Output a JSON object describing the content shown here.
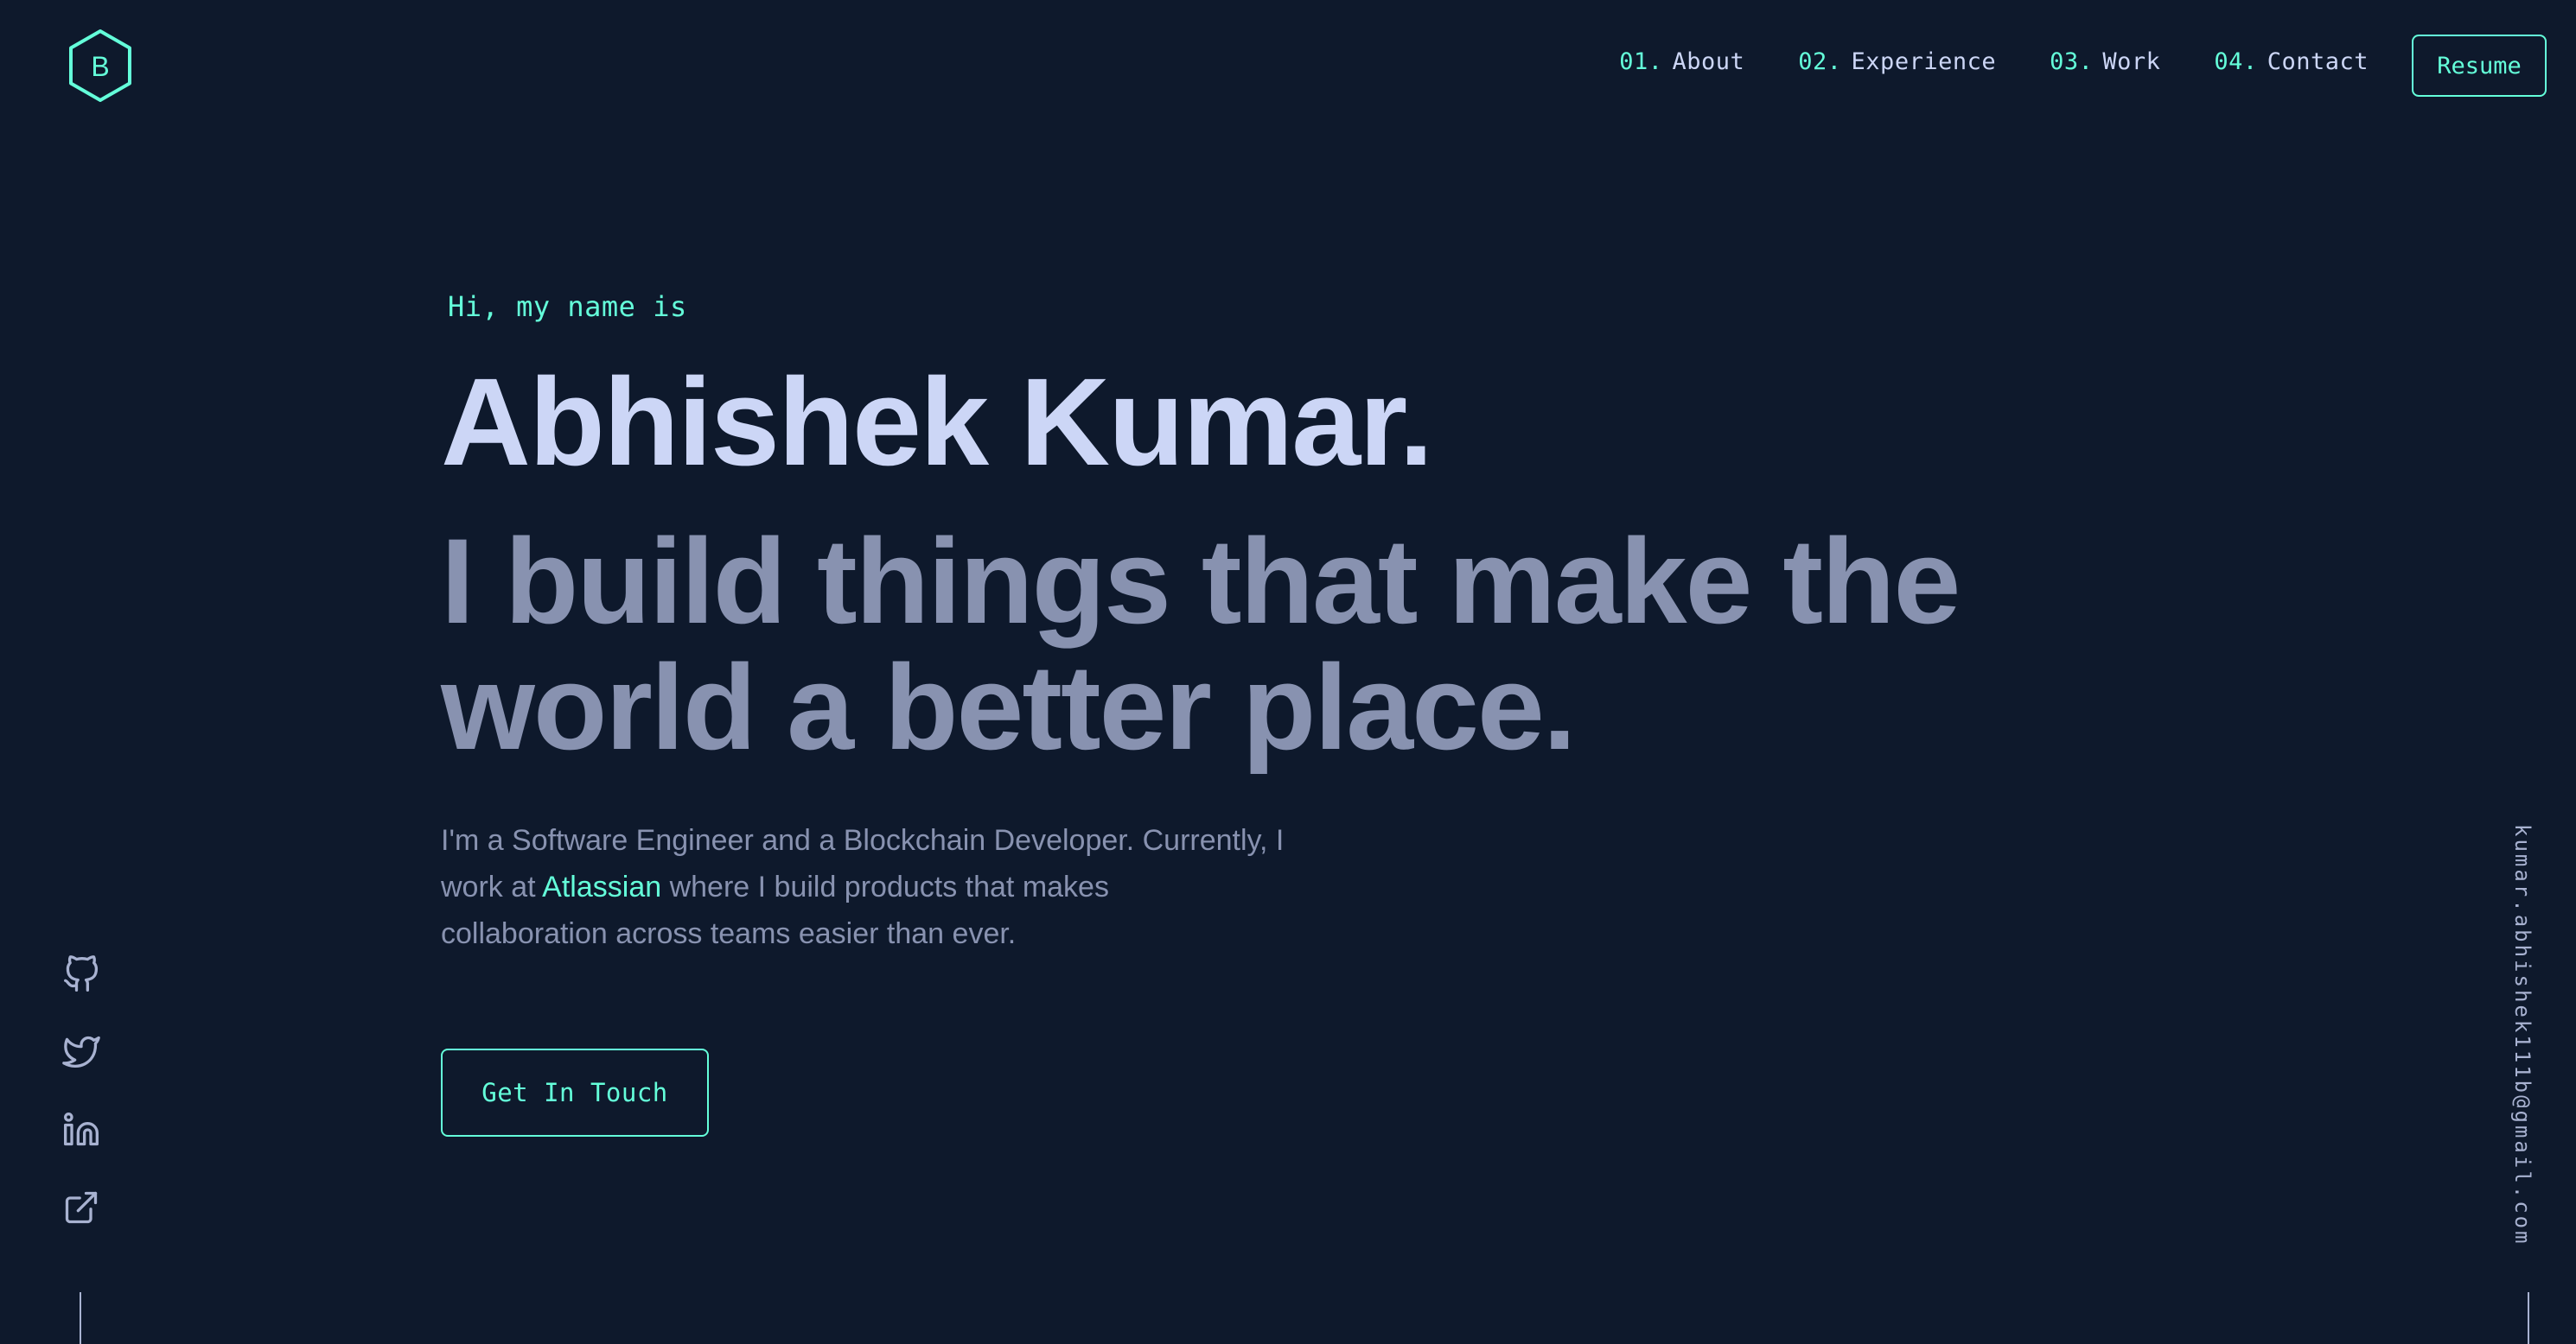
{
  "header": {
    "logo_letter": "B",
    "nav": [
      {
        "num": "01.",
        "label": "About"
      },
      {
        "num": "02.",
        "label": "Experience"
      },
      {
        "num": "03.",
        "label": "Work"
      },
      {
        "num": "04.",
        "label": "Contact"
      }
    ],
    "resume_label": "Resume"
  },
  "hero": {
    "greeting": "Hi, my name is",
    "name": "Abhishek Kumar.",
    "tagline_line1": "I build things that make the",
    "tagline_line2": "world a better place.",
    "intro_line1": "I'm a Software Engineer and a Blockchain Developer. Currently, I",
    "intro_line2_before": "work at ",
    "intro_link": "Atlassian",
    "intro_line2_after": " where I build products that makes",
    "intro_line3": "collaboration across teams easier than ever.",
    "cta_label": "Get In Touch"
  },
  "social": {
    "icons": [
      "github-icon",
      "twitter-icon",
      "linkedin-icon",
      "external-link-icon"
    ]
  },
  "email": "kumar.abhishek111b@gmail.com",
  "colors": {
    "background": "#0e192c",
    "accent": "#64ffda",
    "heading": "#ccd6f6",
    "muted": "#8892b0",
    "rail": "#a8b2d1"
  }
}
